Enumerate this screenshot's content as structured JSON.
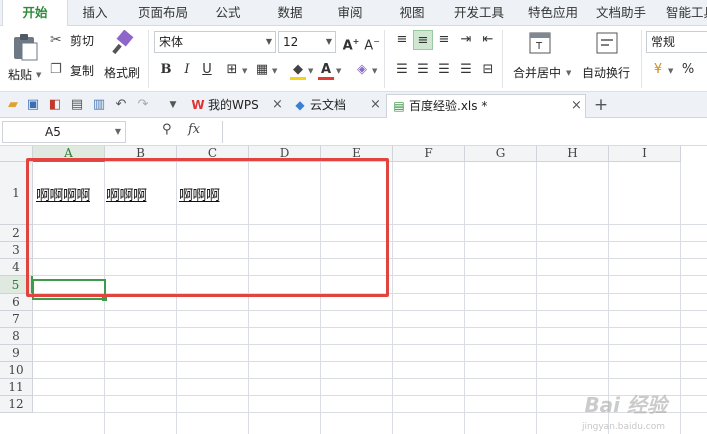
{
  "tabs": [
    "开始",
    "插入",
    "页面布局",
    "公式",
    "数据",
    "审阅",
    "视图",
    "开发工具",
    "特色应用",
    "文档助手",
    "智能工具"
  ],
  "active_tab_index": 0,
  "ribbon": {
    "paste": "粘贴",
    "cut": "剪切",
    "copy": "复制",
    "format_painter": "格式刷",
    "font_name": "宋体",
    "font_size": "12",
    "merge_center": "合并居中",
    "wrap_text": "自动换行",
    "number_format": "常规",
    "percent": "%"
  },
  "doc_tabs": {
    "wps": "我的WPS",
    "cloud": "云文档",
    "file": "百度经验.xls *"
  },
  "formula_bar": {
    "cell_ref": "A5",
    "fx": "fx",
    "value": ""
  },
  "columns": [
    "A",
    "B",
    "C",
    "D",
    "E",
    "F",
    "G",
    "H",
    "I"
  ],
  "rows": [
    "1",
    "2",
    "3",
    "4",
    "5",
    "6",
    "7",
    "8",
    "9",
    "10",
    "11",
    "12"
  ],
  "cells": {
    "A1": "啊啊啊啊",
    "B1": "啊啊啊",
    "C1": "啊啊啊"
  },
  "watermark": "Bai 经验",
  "watermark_sub": "jingyan.baidu.com",
  "colors": {
    "accent": "#3f9b4b",
    "highlight_box": "#e0443e"
  }
}
